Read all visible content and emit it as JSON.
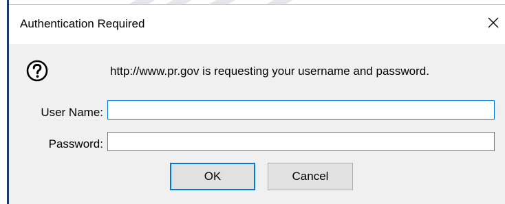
{
  "dialog": {
    "title": "Authentication Required",
    "close_icon": "close-icon",
    "message_icon": "question-icon",
    "message": "http://www.pr.gov is requesting your username and password.",
    "username_label": "User Name:",
    "username_value": "",
    "password_label": "Password:",
    "password_value": "",
    "ok_label": "OK",
    "cancel_label": "Cancel"
  },
  "colors": {
    "focus_accent": "#0078d7",
    "dialog_background": "#f0f0f0",
    "titlebar_background": "#ffffff",
    "button_background": "#e1e1e1"
  }
}
